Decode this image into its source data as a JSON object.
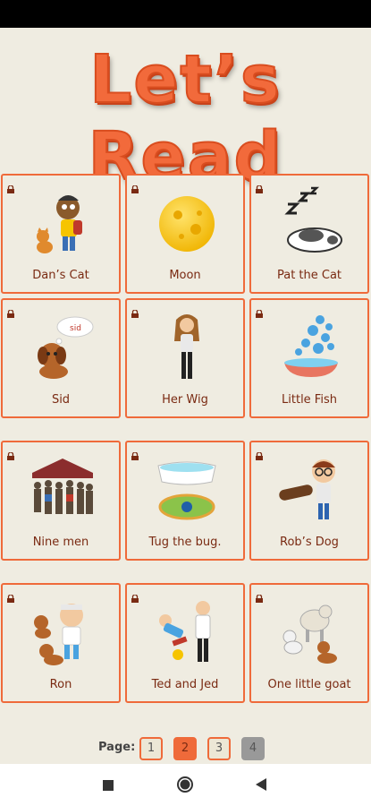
{
  "app": {
    "title": "Let’s Read"
  },
  "stories": [
    {
      "label": "Dan’s Cat",
      "icon": "boy-with-cat-picture",
      "locked": true
    },
    {
      "label": "Moon",
      "icon": "moon-picture",
      "locked": true
    },
    {
      "label": "Pat the Cat",
      "icon": "sleeping-cat-picture",
      "locked": true
    },
    {
      "label": "Sid",
      "icon": "puppy-with-thought-bubble-picture",
      "locked": true,
      "bubble_text": "sid"
    },
    {
      "label": "Her Wig",
      "icon": "woman-picture",
      "locked": true
    },
    {
      "label": "Little Fish",
      "icon": "fish-bowl-bubbles-picture",
      "locked": true
    },
    {
      "label": "Nine men",
      "icon": "group-of-men-picture",
      "locked": true
    },
    {
      "label": "Tug the bug.",
      "icon": "bathtub-and-bug-picture",
      "locked": true
    },
    {
      "label": "Rob’s Dog",
      "icon": "boy-with-log-and-dog-picture",
      "locked": true
    },
    {
      "label": "Ron",
      "icon": "boy-with-dogs-picture",
      "locked": true
    },
    {
      "label": "Ted and Jed",
      "icon": "two-men-picture",
      "locked": true
    },
    {
      "label": "One little goat",
      "icon": "goat-and-animals-picture",
      "locked": true
    }
  ],
  "pager": {
    "label": "Page:",
    "pages": [
      "1",
      "2",
      "3",
      "4"
    ],
    "current": "2",
    "disabled": "4"
  },
  "colors": {
    "accent": "#ef6a3a",
    "background": "#efece1",
    "label_text": "#7a2a12"
  },
  "nav_bar": {
    "icons": [
      "recents-square-icon",
      "home-circle-icon",
      "back-triangle-icon"
    ]
  }
}
